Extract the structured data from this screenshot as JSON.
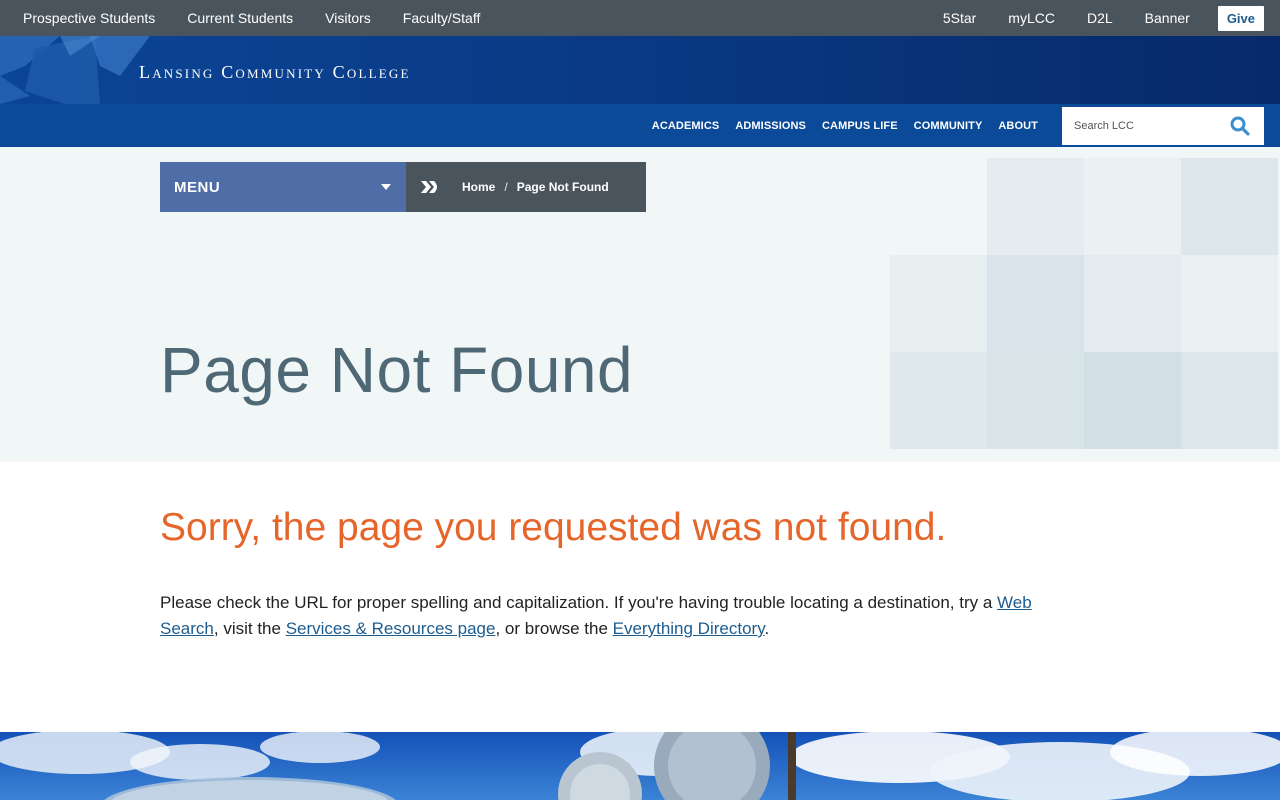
{
  "utility": {
    "left_links": [
      "Prospective Students",
      "Current Students",
      "Visitors",
      "Faculty/Staff"
    ],
    "right_links": [
      "5Star",
      "myLCC",
      "D2L",
      "Banner"
    ],
    "give_label": "Give"
  },
  "brand": {
    "name": "Lansing Community College"
  },
  "mainnav": {
    "items": [
      "ACADEMICS",
      "ADMISSIONS",
      "CAMPUS LIFE",
      "COMMUNITY",
      "ABOUT"
    ],
    "search_placeholder": "Search LCC"
  },
  "hero": {
    "menu_label": "MENU",
    "breadcrumb": {
      "home": "Home",
      "separator": "/",
      "current": "Page Not Found"
    },
    "title": "Page Not Found"
  },
  "content": {
    "heading": "Sorry, the page you requested was not found.",
    "text_1": "Please check the URL for proper spelling and capitalization. If you're having trouble locating a destination, try a ",
    "link_1": "Web Search",
    "text_2": ", visit the ",
    "link_2": "Services & Resources page",
    "text_3": ", or browse the ",
    "link_3": "Everything Directory",
    "text_4": "."
  },
  "colors": {
    "utility_bg": "#49545c",
    "nav_bg": "#0a4a98",
    "menu_bg": "#4f6ea8",
    "accent_orange": "#e5652a",
    "link": "#1d5c8f"
  },
  "icons": {
    "search": "search-icon",
    "menu_chevron": "chevron-down-icon",
    "breadcrumb_arrow": "double-arrow-icon"
  }
}
